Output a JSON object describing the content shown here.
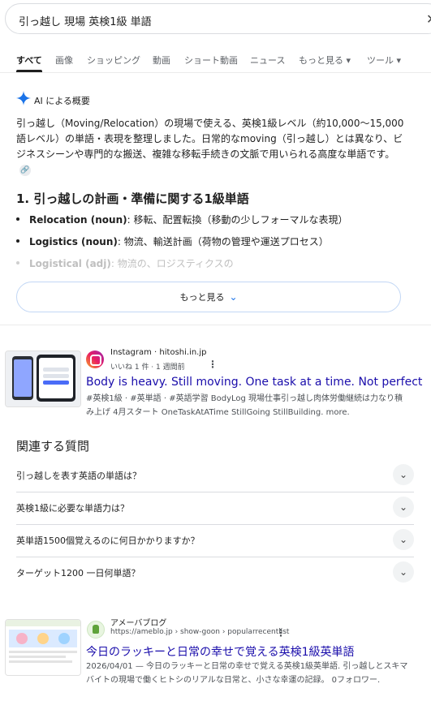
{
  "search": {
    "query": "引っ越し 現場 英検1級 単語",
    "clear_icon": "close-icon"
  },
  "tabs": [
    {
      "label": "すべて",
      "active": true
    },
    {
      "label": "画像"
    },
    {
      "label": "ショッピング"
    },
    {
      "label": "動画"
    },
    {
      "label": "ショート動画"
    },
    {
      "label": "ニュース"
    },
    {
      "label": "もっと見る ▾"
    },
    {
      "label": "ツール ▾"
    }
  ],
  "ai_overview": {
    "label": "AI による概要",
    "body": "引っ越し（Moving/Relocation）の現場で使える、英検1級レベル（約10,000〜15,000語レベル）の単語・表現を整理しました。日常的なmoving（引っ越し）とは異なり、ビジネスシーンや専門的な搬送、複雑な移転手続きの文脈で用いられる高度な単語です。",
    "heading": "1. 引っ越しの計画・準備に関する1級単語",
    "items": [
      {
        "term": "Relocation (noun)",
        "desc": ": 移転、配置転換（移動の少しフォーマルな表現）"
      },
      {
        "term": "Logistics (noun)",
        "desc": ": 物流、輸送計画（荷物の管理や運送プロセス）"
      },
      {
        "term": "Logistical (adj)",
        "desc": ": 物流の、ロジスティクスの"
      }
    ],
    "more_label": "もっと見る",
    "accent": "#1a73e8"
  },
  "result1": {
    "site": "Instagram · hitoshi.in.jp",
    "meta": "いいね 1 件 · 1 週間前",
    "title": "Body is heavy. Still moving. One task at a time. Not perfect",
    "snippet": "#英検1級 · #英単語 · #英語学習 BodyLog 現場仕事引っ越し肉体労働継続は力なり積み上げ 4月スタート OneTaskAtATime StillGoing StillBuilding. more.",
    "thumb_text": "Instagram",
    "kebab": "⋮"
  },
  "related": {
    "heading": "関連する質問",
    "questions": [
      "引っ越しを表す英語の単語は？",
      "英検1級に必要な単語力は？",
      "英単語1500個覚えるのに何日かかりますか？",
      "ターゲット1200 一日何単語？"
    ]
  },
  "result2": {
    "site": "アメーバブログ",
    "meta": "https://ameblo.jp › show-goon › popularrecentlist",
    "title": "今日のラッキーと日常の幸せで覚える英検1級英単語",
    "snippet": "2026/04/01 — 今日のラッキーと日常の幸せで覚える英検1級英単語. 引っ越しとスキマバイトの現場で働くヒトシのリアルな日常と、小さな幸運の記録。 0フォロワー.",
    "thumb_text": "Ameba",
    "kebab": "⋮"
  }
}
